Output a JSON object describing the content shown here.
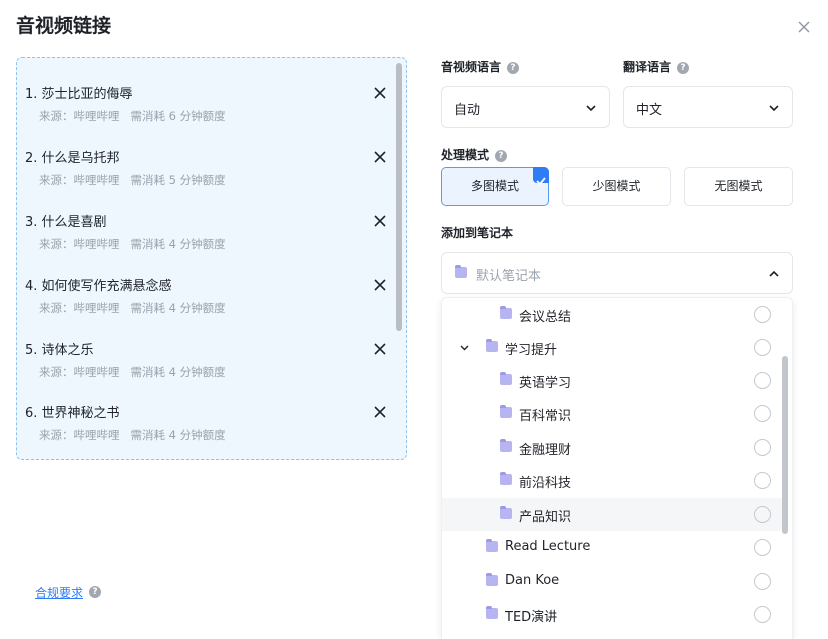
{
  "dialog": {
    "title": "音视频链接"
  },
  "videos": [
    {
      "title": "1. 莎士比亚的侮辱",
      "source": "来源：哔哩哔哩",
      "cost": "需消耗 6 分钟额度"
    },
    {
      "title": "2. 什么是乌托邦",
      "source": "来源：哔哩哔哩",
      "cost": "需消耗 5 分钟额度"
    },
    {
      "title": "3. 什么是喜剧",
      "source": "来源：哔哩哔哩",
      "cost": "需消耗 4 分钟额度"
    },
    {
      "title": "4. 如何使写作充满悬念感",
      "source": "来源：哔哩哔哩",
      "cost": "需消耗 4 分钟额度"
    },
    {
      "title": "5. 诗体之乐",
      "source": "来源：哔哩哔哩",
      "cost": "需消耗 4 分钟额度"
    },
    {
      "title": "6. 世界神秘之书",
      "source": "来源：哔哩哔哩",
      "cost": "需消耗 4 分钟额度"
    }
  ],
  "compliance_link": "合规要求",
  "settings": {
    "av_language_label": "音视频语言",
    "av_language_value": "自动",
    "translate_label": "翻译语言",
    "translate_value": "中文",
    "mode_label": "处理模式",
    "modes": [
      "多图模式",
      "少图模式",
      "无图模式"
    ],
    "active_mode": "多图模式",
    "notebook_label": "添加到笔记本",
    "notebook_placeholder": "默认笔记本"
  },
  "notebook_tree": [
    {
      "label": "会议总结",
      "level": 2
    },
    {
      "label": "学习提升",
      "level": 1,
      "expanded": true
    },
    {
      "label": "英语学习",
      "level": 2
    },
    {
      "label": "百科常识",
      "level": 2
    },
    {
      "label": "金融理财",
      "level": 2
    },
    {
      "label": "前沿科技",
      "level": 2
    },
    {
      "label": "产品知识",
      "level": 2,
      "hovered": true
    },
    {
      "label": "Read Lecture",
      "level": 1
    },
    {
      "label": "Dan Koe",
      "level": 1
    },
    {
      "label": "TED演讲",
      "level": 1
    }
  ],
  "colors": {
    "accent": "#2f7cf6",
    "folder": "#b7b4f2",
    "list_bg": "#eef6fe"
  },
  "icons": {
    "close": "close-icon",
    "remove": "close-icon",
    "help": "help-circle-icon",
    "folder": "folder-icon",
    "chevron": "chevron-down-icon"
  }
}
